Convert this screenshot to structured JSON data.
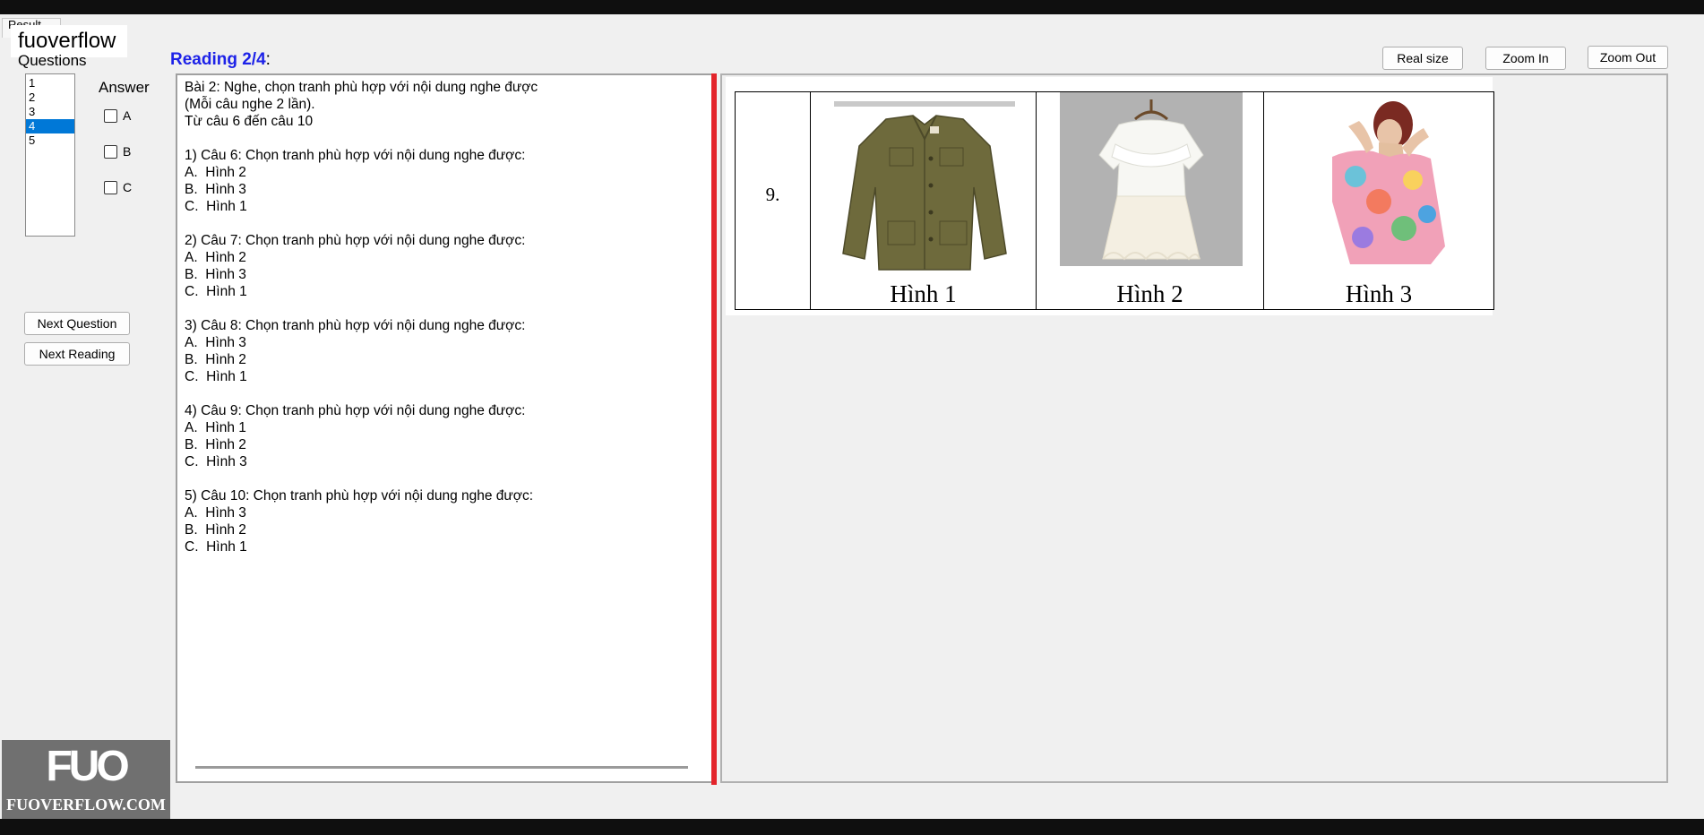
{
  "window": {
    "tab_title": "Result"
  },
  "brand_label": "fuoverflow",
  "questions_label": "Questions",
  "reading": {
    "label": "Reading 2/4",
    "colon": ":"
  },
  "question_list": [
    "1",
    "2",
    "3",
    "4",
    "5"
  ],
  "selected_question": "4",
  "answer": {
    "label": "Answer",
    "options": [
      {
        "label": "A",
        "checked": false
      },
      {
        "label": "B",
        "checked": false
      },
      {
        "label": "C",
        "checked": false
      }
    ]
  },
  "buttons": {
    "next_question": "Next Question",
    "next_reading": "Next Reading",
    "real_size": "Real size",
    "zoom_in": "Zoom In",
    "zoom_out": "Zoom Out"
  },
  "reading_text": [
    "Bài 2: Nghe, chọn tranh phù hợp với nội dung nghe được",
    "(Mỗi câu nghe 2 lần).",
    "Từ câu 6 đến câu 10",
    "",
    "1) Câu 6: Chọn tranh phù hợp với nội dung nghe được:",
    "A.  Hình 2",
    "B.  Hình 3",
    "C.  Hình 1",
    "",
    "2) Câu 7: Chọn tranh phù hợp với nội dung nghe được:",
    "A.  Hình 2",
    "B.  Hình 3",
    "C.  Hình 1",
    "",
    "3) Câu 8: Chọn tranh phù hợp với nội dung nghe được:",
    "A.  Hình 3",
    "B.  Hình 2",
    "C.  Hình 1",
    "",
    "4) Câu 9: Chọn tranh phù hợp với nội dung nghe được:",
    "A.  Hình 1",
    "B.  Hình 2",
    "C.  Hình 3",
    "",
    "5) Câu 10: Chọn tranh phù hợp với nội dung nghe được:",
    "A.  Hình 3",
    "B.  Hình 2",
    "C.  Hình 1"
  ],
  "picture": {
    "number": "9.",
    "captions": [
      "Hình 1",
      "Hình 2",
      "Hình 3"
    ],
    "items": [
      "olive-jacket-photo",
      "white-blouse-skirt-photo",
      "woman-floral-shirt-photo"
    ]
  },
  "logo": {
    "mark": "FUO",
    "text": "FUOVERFLOW.COM"
  },
  "colors": {
    "selection": "#0078d7",
    "reading_label": "#1d22e8",
    "splitter": "#e3242b"
  }
}
